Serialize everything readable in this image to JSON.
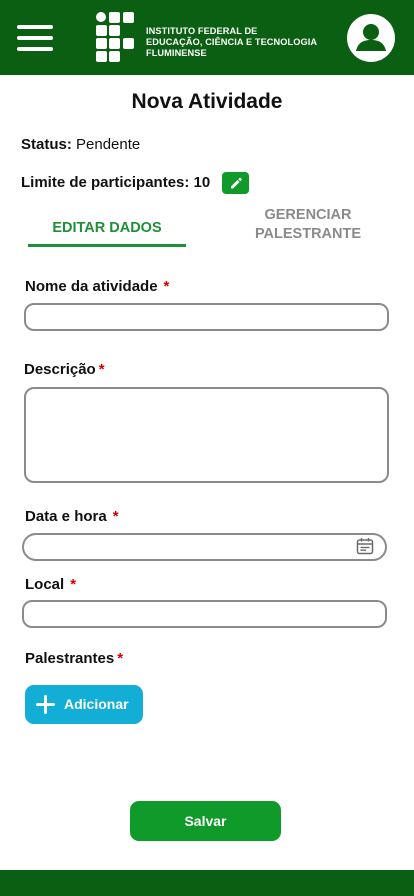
{
  "header": {
    "logo_lines": [
      "INSTITUTO FEDERAL DE",
      "EDUCAÇÃO, CIÊNCIA E TECNOLOGIA",
      "FLUMINENSE"
    ],
    "menu_icon": "hamburger-menu-icon",
    "avatar_icon": "user-avatar-icon"
  },
  "page": {
    "title": "Nova Atividade",
    "status_label": "Status:",
    "status_value": "Pendente",
    "limit_text": "Limite de participantes: 10",
    "edit_icon": "pencil-icon"
  },
  "tabs": {
    "edit": "EDITAR DADOS",
    "speakers": "GERENCIAR PALESTRANTE"
  },
  "form": {
    "name_label": "Nome da atividade",
    "description_label": "Descrição",
    "datetime_label": "Data e hora",
    "location_label": "Local",
    "speakers_label": "Palestrantes",
    "required_mark": "*",
    "name_value": "",
    "description_value": "",
    "datetime_value": "",
    "location_value": ""
  },
  "buttons": {
    "add": "Adicionar",
    "save": "Salvar"
  },
  "colors": {
    "header_green": "#0b5f12",
    "accent_green": "#109a2a",
    "tab_green": "#1f8f3a",
    "add_blue": "#13aed6",
    "required_red": "#d40000"
  }
}
